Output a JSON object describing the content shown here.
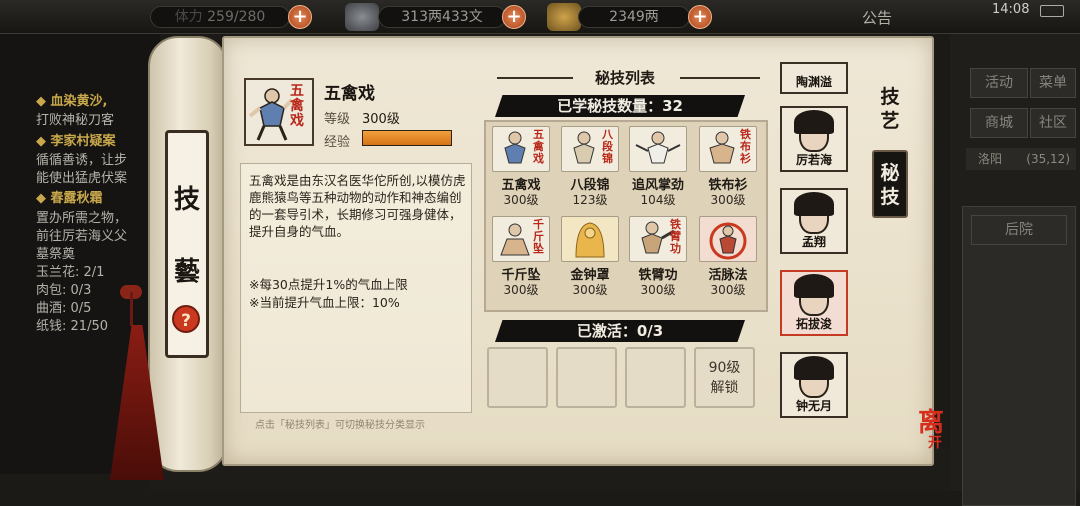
{
  "topbar": {
    "stamina": "259/280",
    "copper": "313两433文",
    "silver": "2349两",
    "notice": "公告",
    "time": "14:08"
  },
  "quests": {
    "q1_title": "血染黄沙,",
    "q1_line": "打败神秘刀客",
    "q2_title": "李家村疑案",
    "q2_line1": "循循善诱，让步",
    "q2_line2": "能使出猛虎伏案",
    "q3_title": "春露秋霜",
    "q3_line1": "置办所需之物，",
    "q3_line2": "前往厉若海义父",
    "q3_line3": "墓祭奠",
    "items": [
      {
        "name": "玉兰花",
        "value": "2/1"
      },
      {
        "name": "肉包",
        "value": "0/3"
      },
      {
        "name": "曲酒",
        "value": "0/5"
      },
      {
        "name": "纸钱",
        "value": "21/50"
      }
    ]
  },
  "right_menu": {
    "activity": "活动",
    "menu": "菜单",
    "shop": "商城",
    "community": "社区",
    "location": "洛阳",
    "coords": "(35,12)",
    "backyard": "后院"
  },
  "roller": {
    "char1": "技",
    "char2": "藝",
    "help": "?"
  },
  "detail": {
    "portrait_text": "五禽戏",
    "name": "五禽戏",
    "level_label": "等级",
    "level_value": "300级",
    "exp_label": "经验",
    "exp_fraction": 1.0,
    "description": "五禽戏是由东汉名医华佗所创,以模仿虎鹿熊猿鸟等五种动物的动作和神态编创的一套导引术，长期修习可强身健体，提升自身的气血。",
    "note1": "※每30点提升1%的气血上限",
    "note2": "※当前提升气血上限：10%",
    "hint": "点击「秘技列表」可切换秘技分类显示"
  },
  "list": {
    "title": "秘技列表",
    "learned_count": "已学秘技数量：32",
    "skills": [
      {
        "name": "五禽戏",
        "level": "300级",
        "icon_text": "五禽戏"
      },
      {
        "name": "八段锦",
        "level": "123级",
        "icon_text": "八段锦"
      },
      {
        "name": "追风掌劲",
        "level": "104级",
        "icon_text": ""
      },
      {
        "name": "铁布衫",
        "level": "300级",
        "icon_text": "铁布衫"
      },
      {
        "name": "千斤坠",
        "level": "300级",
        "icon_text": "千斤坠"
      },
      {
        "name": "金钟罩",
        "level": "300级",
        "icon_text": ""
      },
      {
        "name": "铁臂功",
        "level": "300级",
        "icon_text": "铁臂功"
      },
      {
        "name": "活脉法",
        "level": "300级",
        "icon_text": ""
      }
    ],
    "active_label": "已激活：0/3",
    "locked_slot": "90级\n解锁"
  },
  "characters": [
    {
      "name": "陶渊溢"
    },
    {
      "name": "厉若海"
    },
    {
      "name": "孟翔"
    },
    {
      "name": "拓拔浚"
    },
    {
      "name": "钟无月"
    }
  ],
  "tabs": {
    "skills": "技艺",
    "secret": "秘技"
  },
  "leave": {
    "main": "离",
    "sub": "开"
  },
  "colors": {
    "accent_red": "#c9381f",
    "exp_orange": "#e88a2b",
    "paper": "#ece4d0"
  }
}
